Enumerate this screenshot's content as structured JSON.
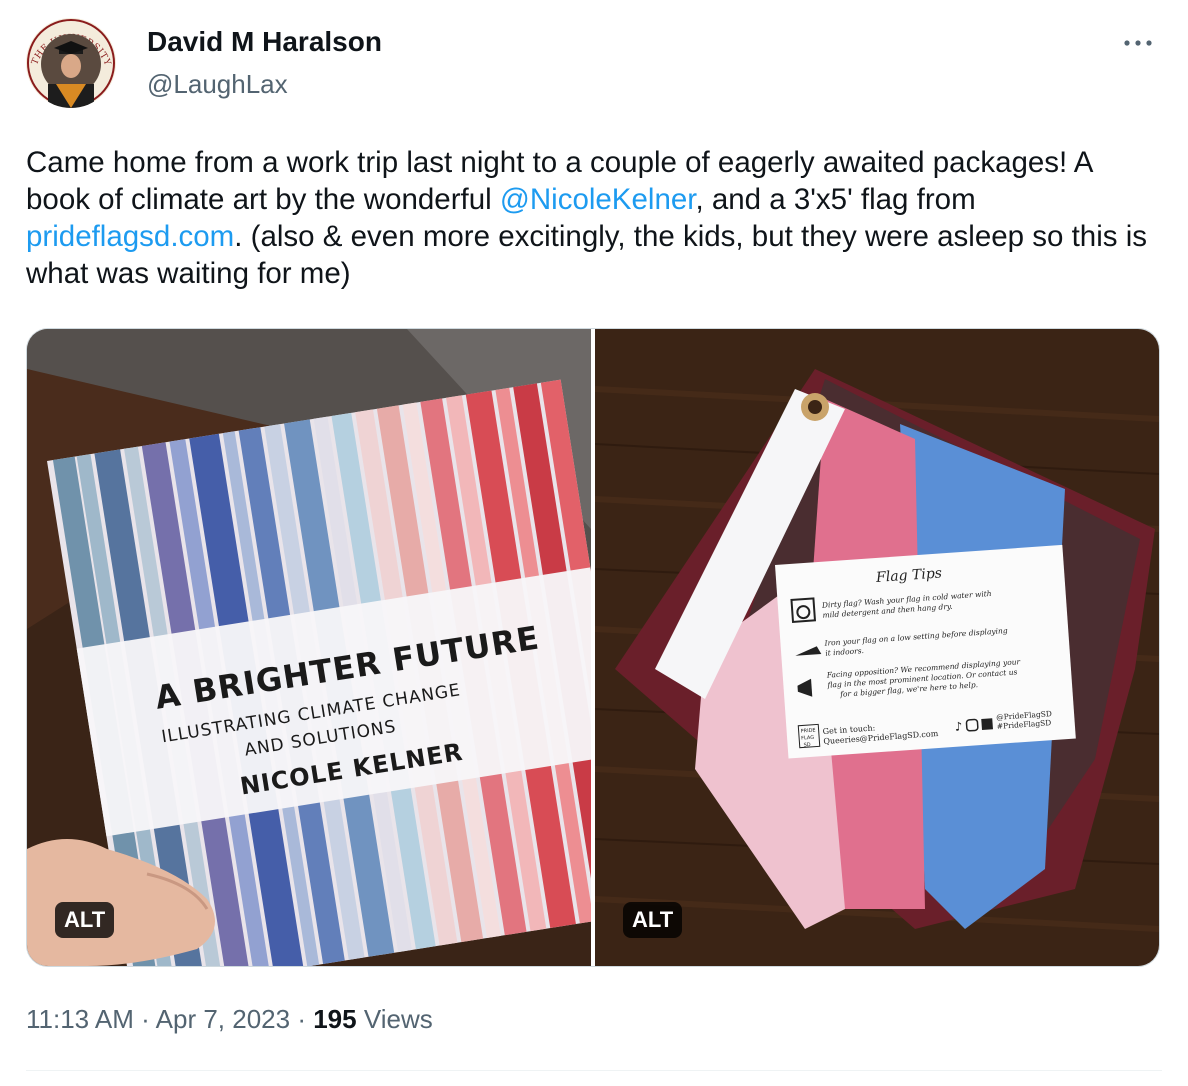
{
  "author": {
    "display_name": "David M Haralson",
    "handle": "@LaughLax",
    "avatar_seal_text": "THE UNIVERSITY OF OKLAHOMA"
  },
  "more_icon": "more-horizontal-icon",
  "tweet": {
    "text_part1": "Came home from a work trip last night to a couple of eagerly awaited packages! A book of climate art by the wonderful ",
    "mention": "@NicoleKelner",
    "text_part2": ", and a 3'x5' flag from ",
    "url": "prideflagsd.com",
    "text_part3": ". (also & even more excitingly, the kids, but they were asleep so this is what was waiting for me)"
  },
  "media": {
    "left": {
      "alt_label": "ALT",
      "book_title": "A BRIGHTER FUTURE",
      "book_subtitle_line1": "ILLUSTRATING CLIMATE CHANGE",
      "book_subtitle_line2": "AND SOLUTIONS",
      "book_author": "NICOLE KELNER"
    },
    "right": {
      "alt_label": "ALT",
      "card_title": "Flag Tips",
      "tip1_line1": "Dirty flag? Wash your flag in cold water with",
      "tip1_line2": "mild detergent and then hang dry.",
      "tip2_line1": "Iron your flag on a low setting before displaying",
      "tip2_line2": "it indoors.",
      "tip3_line1": "Facing opposition? We recommend displaying your",
      "tip3_line2": "flag in the most prominent location. Or contact us",
      "tip3_line3": "for a bigger flag, we're here to help.",
      "contact_label": "Get in touch:",
      "contact_email": "Queeries@PrideFlagSD.com",
      "social_handle": "@PrideFlagSD",
      "hashtag": "#PrideFlagSD",
      "logo_text_1": "PRIDE",
      "logo_text_2": "FLAG",
      "logo_text_3": "SD"
    }
  },
  "timestamp": {
    "time": "11:13 AM",
    "separator": "·",
    "date": "Apr 7, 2023",
    "views_count": "195",
    "views_label": "Views"
  }
}
